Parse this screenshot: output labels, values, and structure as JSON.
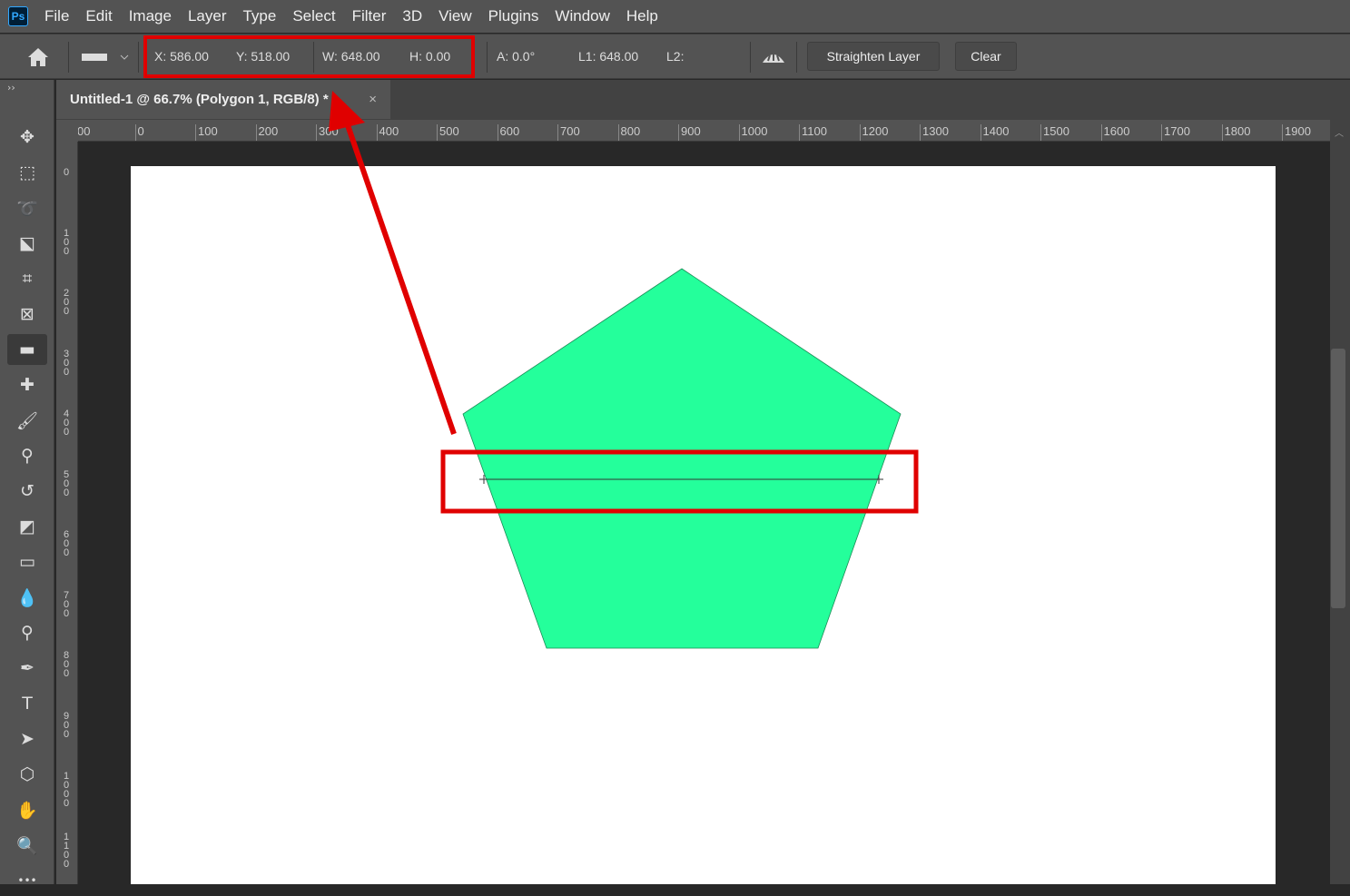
{
  "app": {
    "logo": "Ps",
    "menu": [
      "File",
      "Edit",
      "Image",
      "Layer",
      "Type",
      "Select",
      "Filter",
      "3D",
      "View",
      "Plugins",
      "Window",
      "Help"
    ]
  },
  "options": {
    "x": "X: 586.00",
    "y": "Y: 518.00",
    "w": "W: 648.00",
    "h": "H: 0.00",
    "a": "A: 0.0°",
    "l1": "L1: 648.00",
    "l2": "L2:",
    "straighten": "Straighten Layer",
    "clear": "Clear"
  },
  "document": {
    "tab_title": "Untitled-1 @ 66.7% (Polygon 1, RGB/8) *",
    "close": "×"
  },
  "rulers": {
    "horizontal": [
      "00",
      "0",
      "100",
      "200",
      "300",
      "400",
      "500",
      "600",
      "700",
      "800",
      "900",
      "1000",
      "1100",
      "1200",
      "1300",
      "1400",
      "1500",
      "1600",
      "1700",
      "1800",
      "1900"
    ],
    "vertical": [
      "0",
      "100",
      "200",
      "300",
      "400",
      "500",
      "600",
      "700",
      "800",
      "900",
      "1000",
      "1100"
    ]
  },
  "tools": [
    "move",
    "marquee",
    "lasso",
    "object-select",
    "crop",
    "frame",
    "ruler",
    "healing",
    "brush",
    "stamp",
    "history-brush",
    "eraser",
    "gradient",
    "blur",
    "dodge",
    "pen",
    "type",
    "path-select",
    "shape",
    "hand",
    "zoom",
    "more"
  ],
  "colors": {
    "shape_fill": "#24ff9b",
    "annotation": "#e00000",
    "canvas": "#ffffff"
  }
}
